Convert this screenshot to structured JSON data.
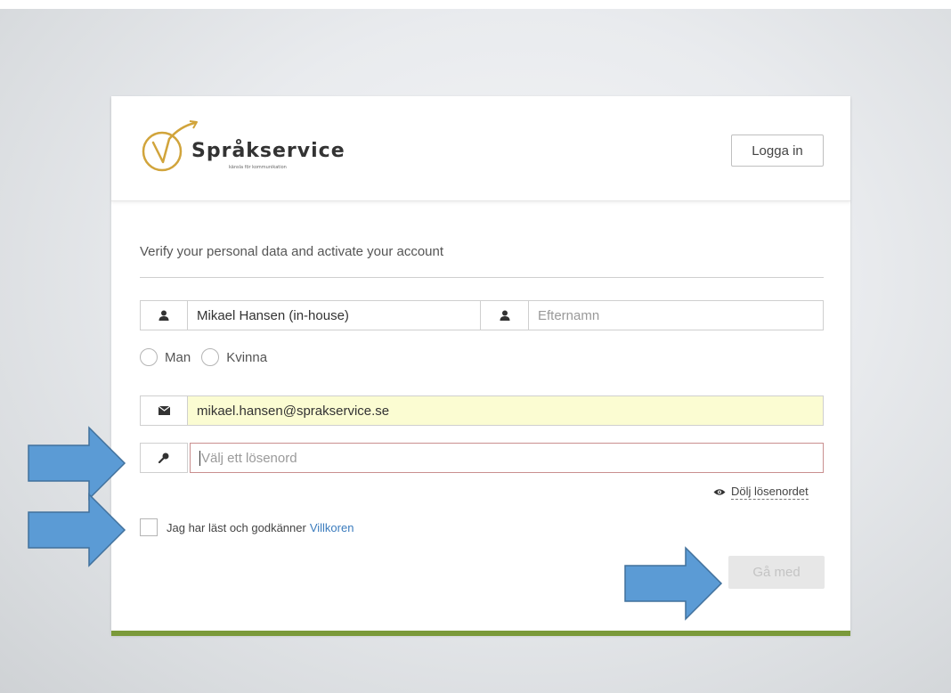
{
  "header": {
    "brand_name": "Språkservice",
    "brand_tagline": "känsla för kommunikation",
    "login_label": "Logga in"
  },
  "form": {
    "subtitle": "Verify your personal data and activate your account",
    "first_name_value": "Mikael Hansen (in-house)",
    "last_name_placeholder": "Efternamn",
    "gender_options": [
      "Man",
      "Kvinna"
    ],
    "email_value": "mikael.hansen@sprakservice.se",
    "password_placeholder": "Välj ett lösenord",
    "hide_password_label": "Dölj lösenordet",
    "terms_text": "Jag har läst och godkänner",
    "terms_link": "Villkoren",
    "join_label": "Gå med"
  },
  "colors": {
    "accent_green": "#7b9a3a",
    "logo_gold": "#d1a43b",
    "link_blue": "#3a7bbd",
    "annotation_arrow": "#5b9bd5",
    "email_autofill_bg": "#fbfcd2",
    "password_invalid_border": "#c98f8f"
  },
  "icons": {
    "first_name": "user-icon",
    "last_name": "user-icon",
    "email": "envelope-icon",
    "password": "key-icon",
    "hide_password": "eye-icon"
  }
}
